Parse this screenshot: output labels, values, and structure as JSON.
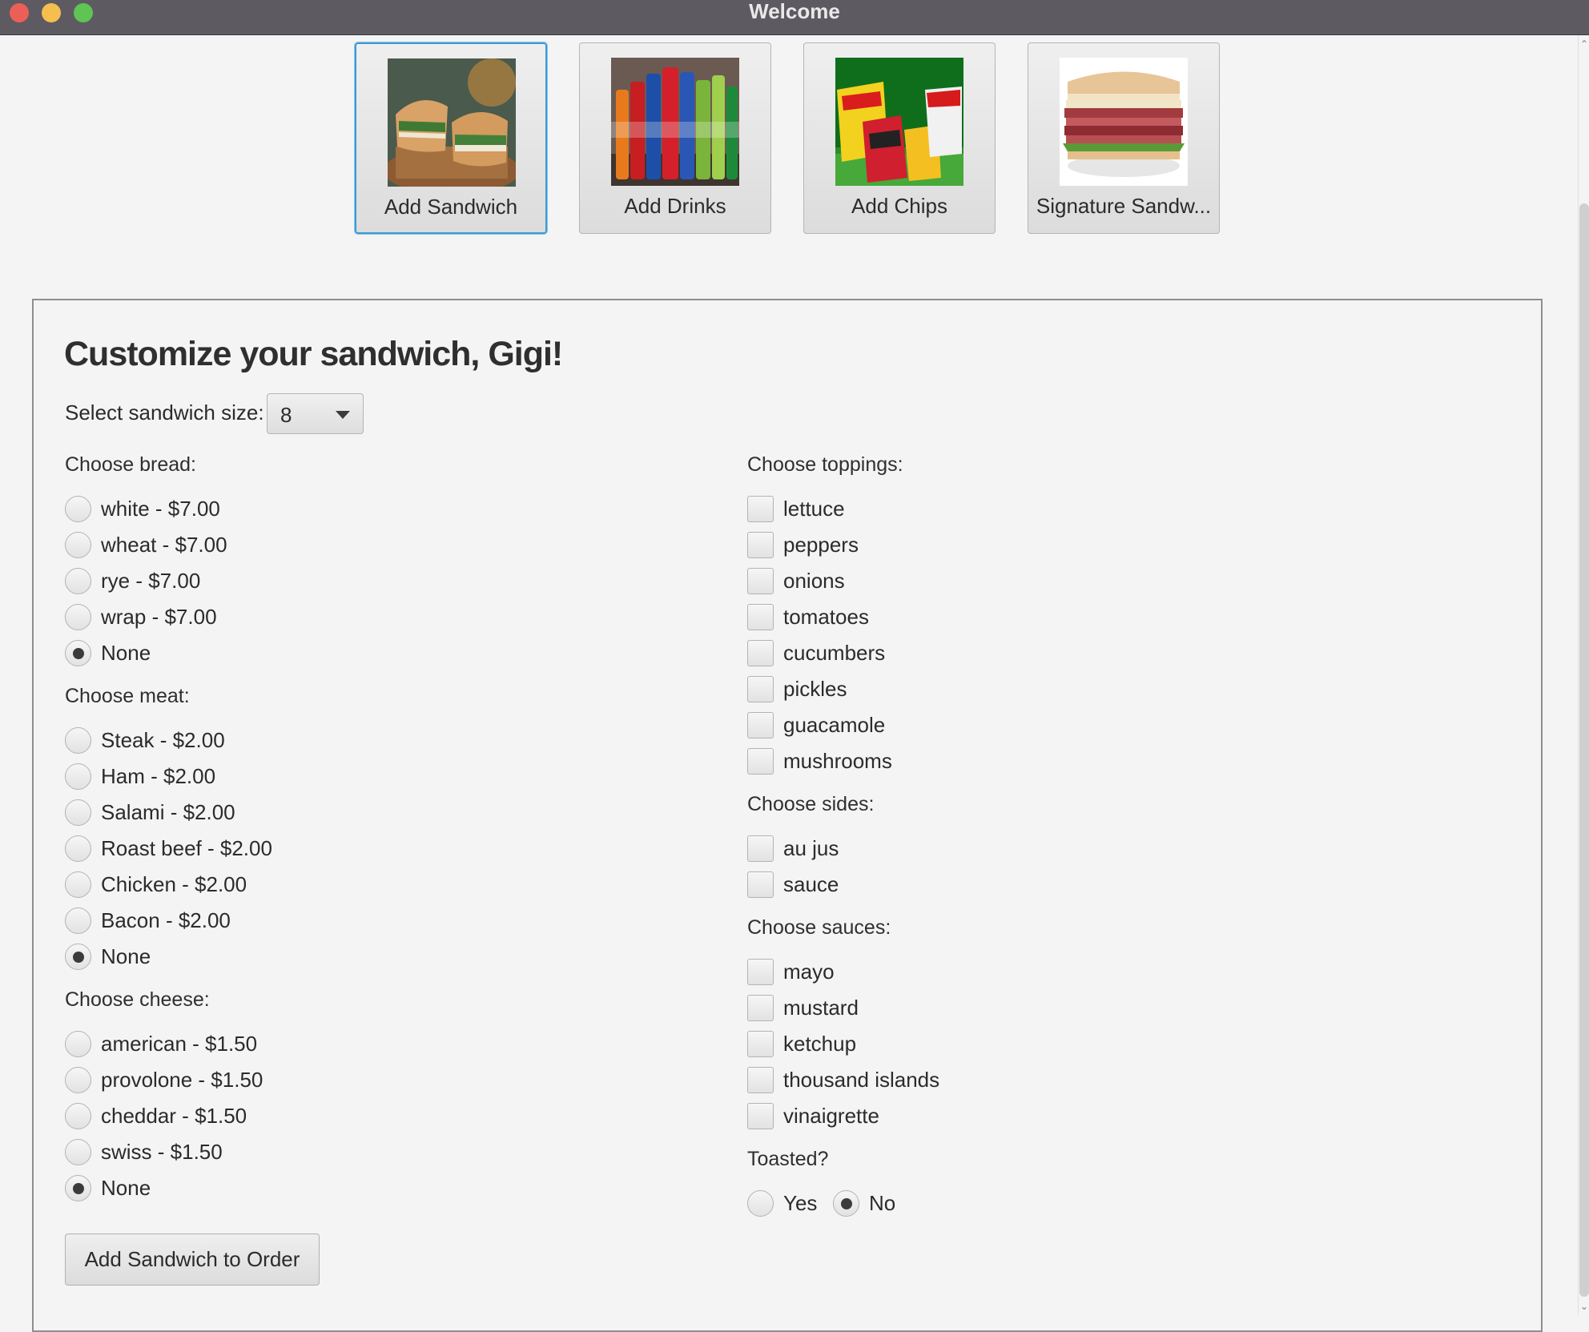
{
  "window": {
    "title": "Welcome"
  },
  "nav": [
    {
      "label": "Add Sandwich",
      "icon": "sandwich-image",
      "active": true
    },
    {
      "label": "Add Drinks",
      "icon": "drinks-image"
    },
    {
      "label": "Add Chips",
      "icon": "chips-image"
    },
    {
      "label": "Signature Sandw...",
      "icon": "signature-sandwich-image"
    }
  ],
  "form": {
    "heading": "Customize your sandwich, Gigi!",
    "size_label": "Select sandwich size:",
    "size_value": "8",
    "bread_label": "Choose bread:",
    "bread": [
      "white - $7.00",
      "wheat - $7.00",
      "rye - $7.00",
      "wrap - $7.00",
      "None"
    ],
    "bread_selected": "None",
    "meat_label": "Choose meat:",
    "meat": [
      "Steak - $2.00",
      "Ham - $2.00",
      "Salami - $2.00",
      "Roast beef - $2.00",
      "Chicken - $2.00",
      "Bacon - $2.00",
      "None"
    ],
    "meat_selected": "None",
    "cheese_label": "Choose cheese:",
    "cheese": [
      "american - $1.50",
      "provolone - $1.50",
      "cheddar - $1.50",
      "swiss - $1.50",
      "None"
    ],
    "cheese_selected": "None",
    "toppings_label": "Choose toppings:",
    "toppings": [
      "lettuce",
      "peppers",
      "onions",
      "tomatoes",
      "cucumbers",
      "pickles",
      "guacamole",
      "mushrooms"
    ],
    "sides_label": "Choose sides:",
    "sides": [
      "au jus",
      "sauce"
    ],
    "sauces_label": "Choose sauces:",
    "sauces": [
      "mayo",
      "mustard",
      "ketchup",
      "thousand islands",
      "vinaigrette"
    ],
    "toasted_label": "Toasted?",
    "toasted": [
      "Yes",
      "No"
    ],
    "toasted_selected": "No",
    "submit_label": "Add Sandwich to Order"
  },
  "colors": {
    "accent": "#3c9ad6",
    "titlebar": "#5d5b61"
  }
}
